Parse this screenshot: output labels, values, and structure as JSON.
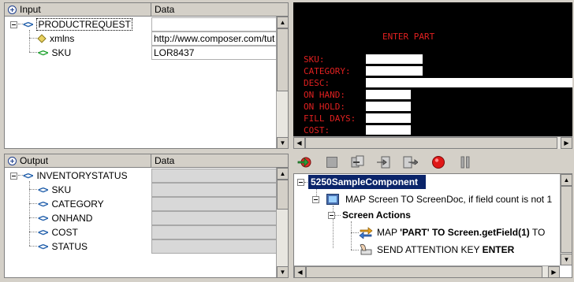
{
  "input_panel": {
    "col_name": "Input",
    "col_data": "Data",
    "rows": [
      {
        "label": "PRODUCTREQUEST",
        "value": ""
      },
      {
        "label": "xmlns",
        "value": "http://www.composer.com/tut"
      },
      {
        "label": "SKU",
        "value": "LOR8437"
      }
    ]
  },
  "output_panel": {
    "col_name": "Output",
    "col_data": "Data",
    "rows": [
      {
        "label": "INVENTORYSTATUS"
      },
      {
        "label": "SKU"
      },
      {
        "label": "CATEGORY"
      },
      {
        "label": "ONHAND"
      },
      {
        "label": "COST"
      },
      {
        "label": "STATUS"
      }
    ]
  },
  "terminal": {
    "title": "ENTER PART",
    "fields": [
      {
        "label": "SKU:"
      },
      {
        "label": "CATEGORY:"
      },
      {
        "label": "DESC:"
      },
      {
        "label": "ON HAND:"
      },
      {
        "label": "ON HOLD:"
      },
      {
        "label": "FILL DAYS:"
      },
      {
        "label": "COST:"
      }
    ]
  },
  "toolbar": {
    "buttons": [
      "run-icon",
      "stop-icon",
      "step-over-icon",
      "step-into-icon",
      "step-out-icon",
      "record-icon",
      "pause-icon"
    ]
  },
  "actions": {
    "component": "5250SampleComponent",
    "map_screen": "MAP Screen TO ScreenDoc, if field count is not 1",
    "screen_actions": "Screen Actions",
    "map_part_prefix": "MAP ",
    "map_part_bold": "'PART' TO Screen.getField(1)",
    "map_part_suffix": " TO",
    "send_key_prefix": "SEND ATTENTION KEY ",
    "send_key_bold": "ENTER"
  },
  "colors": {
    "terminal_bg": "#000000",
    "terminal_text": "#e02020",
    "selection": "#0a246a"
  }
}
